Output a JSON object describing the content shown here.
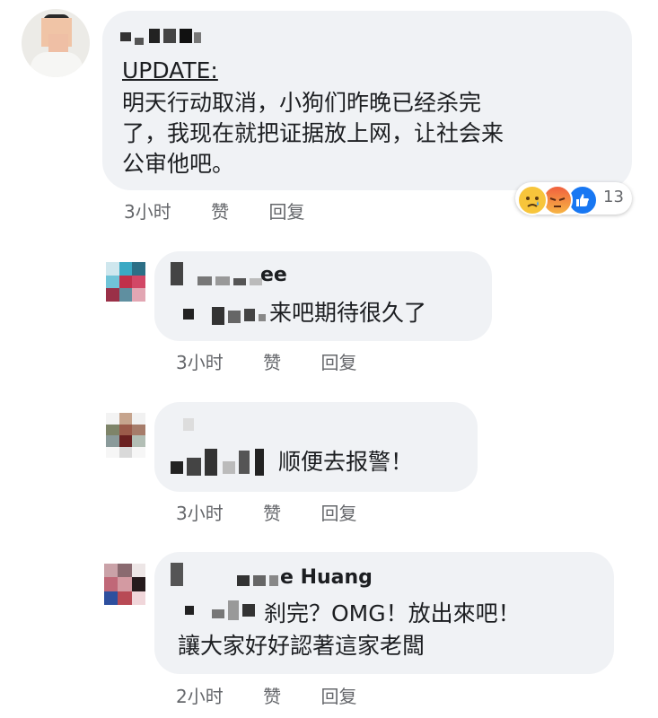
{
  "main_comment": {
    "update_label": "UPDATE:",
    "body_lines": [
      "明天行动取消，小狗们昨晚已经杀完",
      "了，我现在就把证据放上网，让社会来",
      "公审他吧。"
    ],
    "time": "3小时",
    "like": "赞",
    "reply": "回复",
    "reaction_count": "13",
    "reaction_icons": [
      "sad-icon",
      "angry-icon",
      "like-icon"
    ]
  },
  "replies": [
    {
      "name_visible": "ee",
      "text": "来吧期待很久了",
      "time": "3小时",
      "like": "赞",
      "reply": "回复"
    },
    {
      "text": "顺便去报警！",
      "time": "3小时",
      "like": "赞",
      "reply": "回复"
    },
    {
      "name_visible": "e Huang",
      "text_lines": [
        "刹完？OMG！放出來吧！",
        "讓大家好好認著這家老闆"
      ],
      "time": "2小时",
      "like": "赞",
      "reply": "回复"
    }
  ],
  "colors": {
    "bubble": "#f0f2f5",
    "meta_text": "#65676b",
    "like_blue": "#1877f2"
  }
}
